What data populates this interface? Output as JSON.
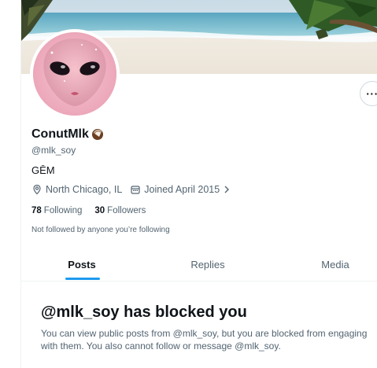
{
  "profile": {
    "display_name": "ConutMlk",
    "handle": "@mlk_soy",
    "bio": "GĒM",
    "location": "North Chicago, IL",
    "joined": "Joined April 2015",
    "following_count": "78",
    "following_label": "Following",
    "followers_count": "30",
    "followers_label": "Followers",
    "not_followed_text": "Not followed by anyone you’re following"
  },
  "tabs": [
    {
      "label": "Posts",
      "active": true
    },
    {
      "label": "Replies",
      "active": false
    },
    {
      "label": "Media",
      "active": false
    }
  ],
  "blocked": {
    "title": "@mlk_soy has blocked you",
    "message": "You can view public posts from @mlk_soy, but you are blocked from engaging with them. You also cannot follow or message @mlk_soy."
  },
  "icons": {
    "more": "more-icon",
    "location": "location-pin-icon",
    "calendar": "calendar-icon",
    "chevron": "chevron-right-icon",
    "emoji": "coconut-emoji"
  },
  "colors": {
    "accent": "#1d9bf0",
    "text_primary": "#0f1419",
    "text_secondary": "#536471",
    "border": "#eff3f4"
  }
}
